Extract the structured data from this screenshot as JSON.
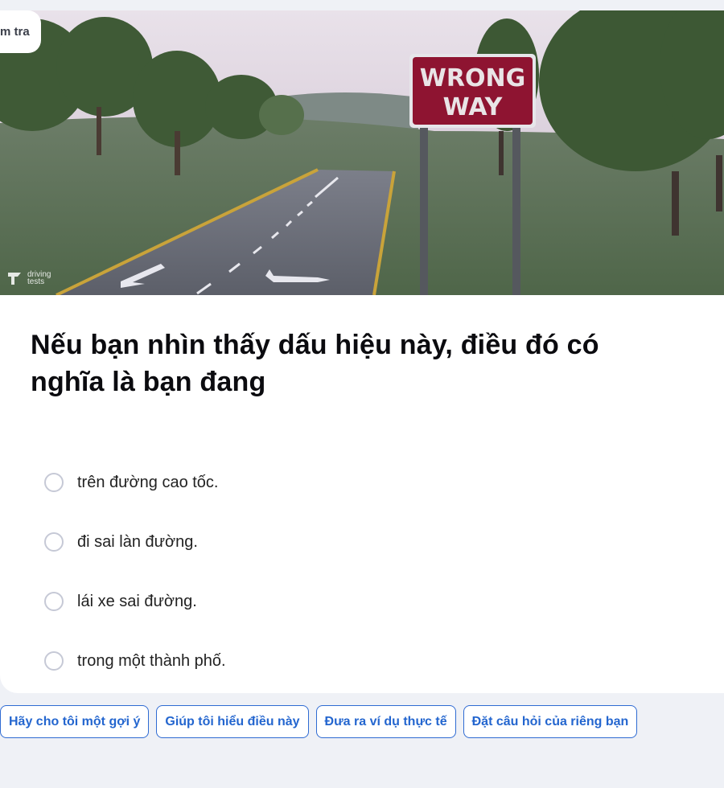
{
  "tag": {
    "label": "m tra"
  },
  "image": {
    "sign_line1": "WRONG",
    "sign_line2": "WAY",
    "watermark": "driving\ntests"
  },
  "question": {
    "text": "Nếu bạn nhìn thấy dấu hiệu này, điều đó có nghĩa là bạn đang",
    "options": [
      {
        "label": "trên đường cao tốc."
      },
      {
        "label": "đi sai làn đường."
      },
      {
        "label": "lái xe sai đường."
      },
      {
        "label": "trong một thành phố."
      }
    ]
  },
  "actions": [
    {
      "label": "Hãy cho tôi một gợi ý"
    },
    {
      "label": "Giúp tôi hiểu điều này"
    },
    {
      "label": "Đưa ra ví dụ thực tế"
    },
    {
      "label": "Đặt câu hỏi của riêng bạn"
    }
  ],
  "colors": {
    "page_bg": "#eff1f6",
    "accent": "#2466cf",
    "sign_red": "#8e1431"
  }
}
